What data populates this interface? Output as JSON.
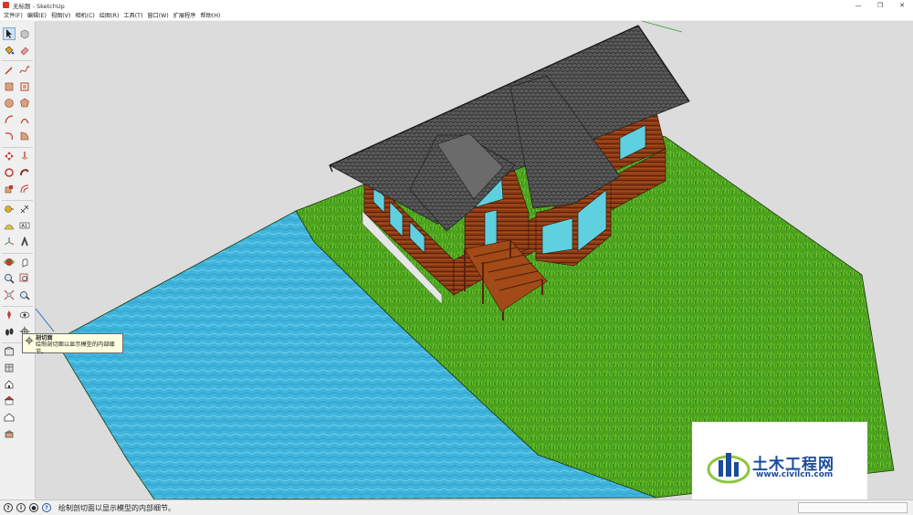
{
  "window": {
    "title": "无标题 - SketchUp",
    "minimize": "—",
    "restore": "❐",
    "close": "✕"
  },
  "menu": [
    "文件(F)",
    "编辑(E)",
    "视图(V)",
    "相机(C)",
    "绘图(R)",
    "工具(T)",
    "窗口(W)",
    "扩展程序",
    "帮助(H)"
  ],
  "tooltip": {
    "title": "剖切面",
    "line1": "绘制剖切面以显示模型的内部细",
    "line2": "节。"
  },
  "status": {
    "text": "绘制剖切面以显示模型的内部细节。",
    "measure_label": ""
  },
  "watermark": {
    "name": "土木工程网",
    "url": "www.civilcn.com"
  },
  "colors": {
    "water": "#3fb4dc",
    "grass": "#4aa21e",
    "roof": "#5a5a5a",
    "wood": "#8c3a14",
    "glass": "#5fd0e0",
    "ground": "#dcdcdc"
  },
  "tools": [
    "select-icon",
    "eraser-icon",
    "paint-bucket-icon",
    "eraser-alt-icon",
    "pencil-line-icon",
    "freehand-icon",
    "rectangle-icon",
    "rotated-rectangle-icon",
    "circle-icon",
    "polygon-icon",
    "arc-icon",
    "pie-icon",
    "arc-2pt-icon",
    "arc-3pt-icon",
    "move-icon",
    "push-pull-icon",
    "rotate-icon",
    "follow-me-icon",
    "scale-icon",
    "offset-icon",
    "tape-measure-icon",
    "dimension-icon",
    "protractor-icon",
    "text-icon",
    "axes-icon",
    "3d-text-icon",
    "orbit-icon",
    "pan-icon",
    "zoom-icon",
    "zoom-window-icon",
    "zoom-extents-icon",
    "previous-view-icon",
    "position-camera-icon",
    "look-around-icon",
    "walk-icon",
    "section-plane-icon",
    "warehouse-icon",
    "extension-warehouse-icon",
    "layout-icon",
    "house-1-icon",
    "house-2-icon",
    "house-3-icon",
    "house-4-icon"
  ]
}
